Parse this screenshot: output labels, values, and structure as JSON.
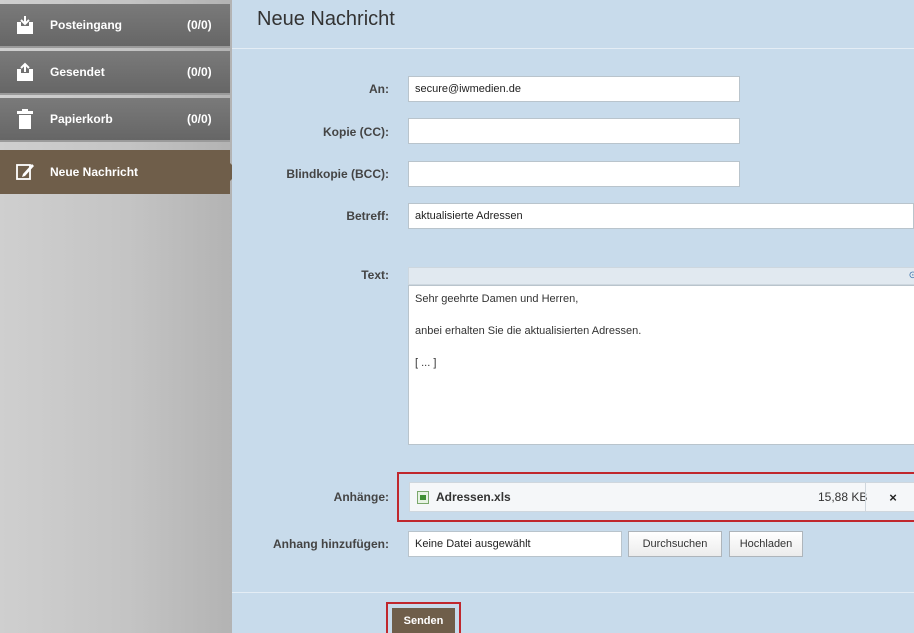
{
  "sidebar": {
    "items": [
      {
        "label": "Posteingang",
        "count": "(0/0)",
        "icon": "inbox-icon"
      },
      {
        "label": "Gesendet",
        "count": "(0/0)",
        "icon": "outbox-icon"
      },
      {
        "label": "Papierkorb",
        "count": "(0/0)",
        "icon": "trash-icon"
      },
      {
        "label": "Neue Nachricht",
        "icon": "compose-icon",
        "active": true
      }
    ]
  },
  "main": {
    "title": "Neue Nachricht",
    "fields": {
      "to_label": "An:",
      "to_value": "secure@iwmedien.de",
      "cc_label": "Kopie (CC):",
      "cc_value": "",
      "bcc_label": "Blindkopie (BCC):",
      "bcc_value": "",
      "subject_label": "Betreff:",
      "subject_value": "aktualisierte Adressen",
      "text_label": "Text:"
    },
    "editor": {
      "source_marker": "⊙",
      "lines": [
        "Sehr geehrte Damen und Herren,",
        "anbei erhalten Sie die aktualisierten Adressen.",
        "[ ... ]"
      ]
    },
    "attachments": {
      "label": "Anhänge:",
      "items": [
        {
          "name": "Adressen.xls",
          "size": "15,88 KB",
          "remove": "×",
          "icon": "xls-file-icon"
        }
      ]
    },
    "add_attachment": {
      "label": "Anhang hinzufügen:",
      "file_status": "Keine Datei ausgewählt",
      "browse_label": "Durchsuchen",
      "upload_label": "Hochladen"
    },
    "send_label": "Senden"
  },
  "colors": {
    "accent_brown": "#6f5e4a",
    "main_background": "#c8dbeb",
    "highlight_red": "#c0272d"
  }
}
